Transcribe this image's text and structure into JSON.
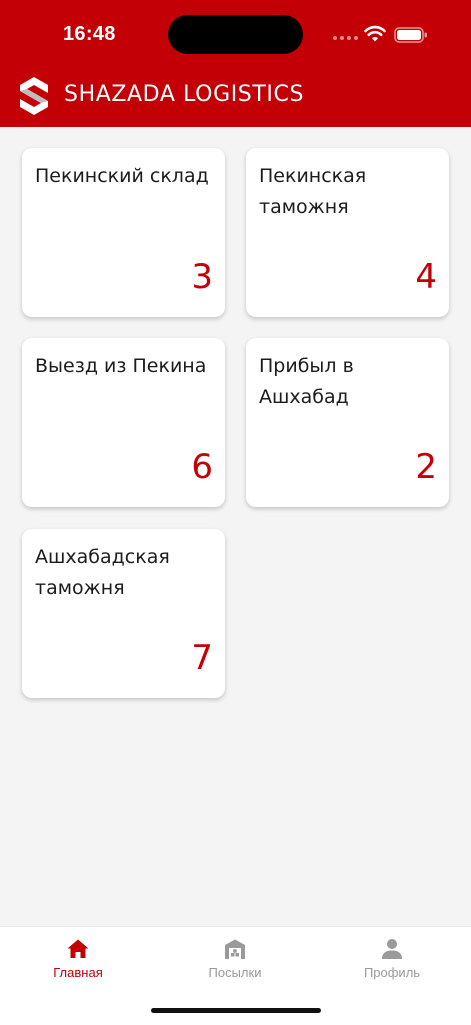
{
  "status_bar": {
    "time": "16:48"
  },
  "header": {
    "brand": "SHAZADA LOGISTICS",
    "background": "#c20006",
    "logo_icon": "shazada-logo-icon"
  },
  "cards": [
    {
      "label": "Пекинский склад",
      "count": "3"
    },
    {
      "label": "Пекинская таможня",
      "count": "4"
    },
    {
      "label": "Выезд из Пекина",
      "count": "6"
    },
    {
      "label": "Прибыл в Ашхабад",
      "count": "2"
    },
    {
      "label": "Ашхабадская таможня",
      "count": "7"
    }
  ],
  "tabbar": {
    "items": [
      {
        "label": "Главная",
        "icon": "home-icon",
        "active": true
      },
      {
        "label": "Посылки",
        "icon": "warehouse-icon",
        "active": false
      },
      {
        "label": "Профиль",
        "icon": "person-icon",
        "active": false
      }
    ]
  },
  "colors": {
    "accent": "#c20006",
    "background": "#f4f4f4",
    "inactive": "#9a9a9a"
  }
}
